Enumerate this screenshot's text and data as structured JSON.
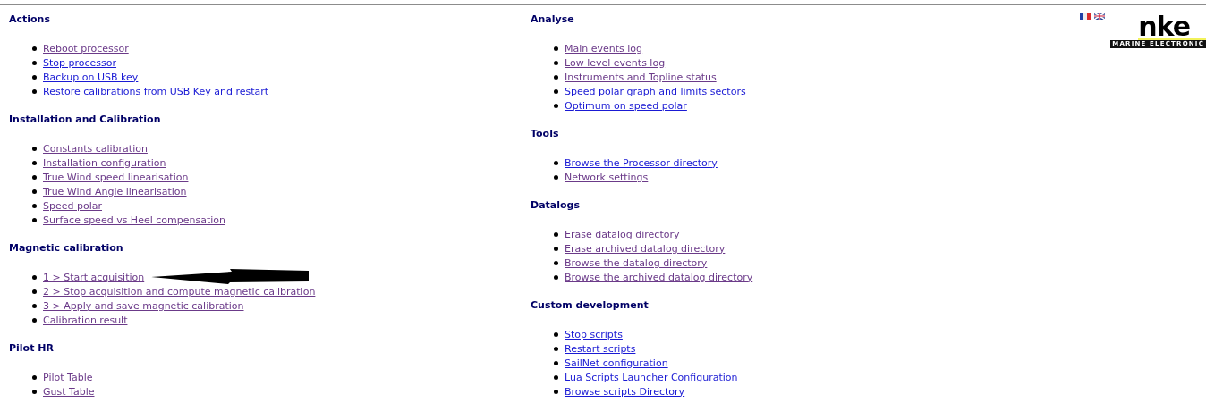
{
  "columns": [
    [
      {
        "title": "Actions",
        "items": [
          {
            "label": "Reboot processor",
            "visited": true
          },
          {
            "label": "Stop processor",
            "visited": false
          },
          {
            "label": "Backup on USB key",
            "visited": false
          },
          {
            "label": "Restore calibrations from USB Key and restart",
            "visited": false
          }
        ]
      },
      {
        "title": "Installation and Calibration",
        "items": [
          {
            "label": "Constants calibration",
            "visited": true
          },
          {
            "label": "Installation configuration",
            "visited": true
          },
          {
            "label": "True Wind speed linearisation",
            "visited": true
          },
          {
            "label": "True Wind Angle linearisation",
            "visited": true
          },
          {
            "label": "Speed polar",
            "visited": true
          },
          {
            "label": "Surface speed vs Heel compensation",
            "visited": true
          }
        ]
      },
      {
        "title": "Magnetic calibration",
        "items": [
          {
            "label": "1 > Start acquisition",
            "visited": true,
            "arrow": true
          },
          {
            "label": "2 > Stop acquisition and compute magnetic calibration",
            "visited": true,
            "arrow": false
          },
          {
            "label": "3 > Apply and save magnetic calibration",
            "visited": true,
            "arrow": false
          },
          {
            "label": "Calibration result",
            "visited": true,
            "arrow": false
          }
        ]
      },
      {
        "title": "Pilot HR",
        "items": [
          {
            "label": "Pilot Table",
            "visited": true
          },
          {
            "label": "Gust Table",
            "visited": true
          }
        ]
      }
    ],
    [
      {
        "title": "Analyse",
        "items": [
          {
            "label": "Main events log",
            "visited": true
          },
          {
            "label": "Low level events log",
            "visited": true
          },
          {
            "label": "Instruments and Topline status",
            "visited": true
          },
          {
            "label": "Speed polar graph and limits sectors",
            "visited": false
          },
          {
            "label": "Optimum on speed polar",
            "visited": false
          }
        ]
      },
      {
        "title": "Tools",
        "items": [
          {
            "label": "Browse the Processor directory",
            "visited": false
          },
          {
            "label": "Network settings",
            "visited": true
          }
        ]
      },
      {
        "title": "Datalogs",
        "items": [
          {
            "label": "Erase datalog directory",
            "visited": true
          },
          {
            "label": "Erase archived datalog directory",
            "visited": true
          },
          {
            "label": "Browse the datalog directory",
            "visited": true
          },
          {
            "label": "Browse the archived datalog directory",
            "visited": true
          }
        ]
      },
      {
        "title": "Custom development",
        "items": [
          {
            "label": "Stop scripts",
            "visited": false
          },
          {
            "label": "Restart scripts",
            "visited": false
          },
          {
            "label": "SailNet configuration",
            "visited": false
          },
          {
            "label": "Lua Scripts Launcher Configuration",
            "visited": false
          },
          {
            "label": "Browse scripts Directory",
            "visited": false
          }
        ]
      }
    ]
  ],
  "logo": {
    "brand": "nke",
    "tagline": "MARINE ELECTRONIC"
  }
}
